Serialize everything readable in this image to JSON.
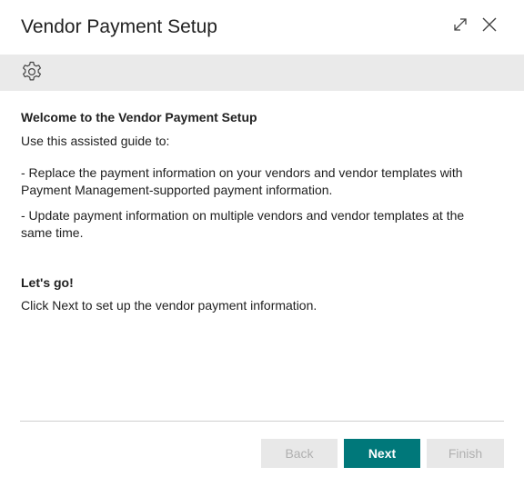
{
  "dialog": {
    "title": "Vendor Payment Setup"
  },
  "icons": {
    "expand": "expand-icon",
    "close": "close-icon",
    "settings": "gear-icon"
  },
  "content": {
    "welcome_heading": "Welcome to the Vendor Payment Setup",
    "intro": "Use this assisted guide to:",
    "bullets": [
      "- Replace the payment information on your vendors and vendor templates with Payment Management-supported payment information.",
      "- Update payment information on multiple vendors and vendor templates at the same time."
    ],
    "letsgo_heading": "Let's go!",
    "letsgo_text": "Click Next to set up the vendor payment information."
  },
  "footer": {
    "back_label": "Back",
    "next_label": "Next",
    "finish_label": "Finish"
  },
  "colors": {
    "accent": "#00787a",
    "toolbar_bg": "#eaeaea",
    "disabled_bg": "#e8e8e8",
    "disabled_text": "#b0b0b0"
  }
}
